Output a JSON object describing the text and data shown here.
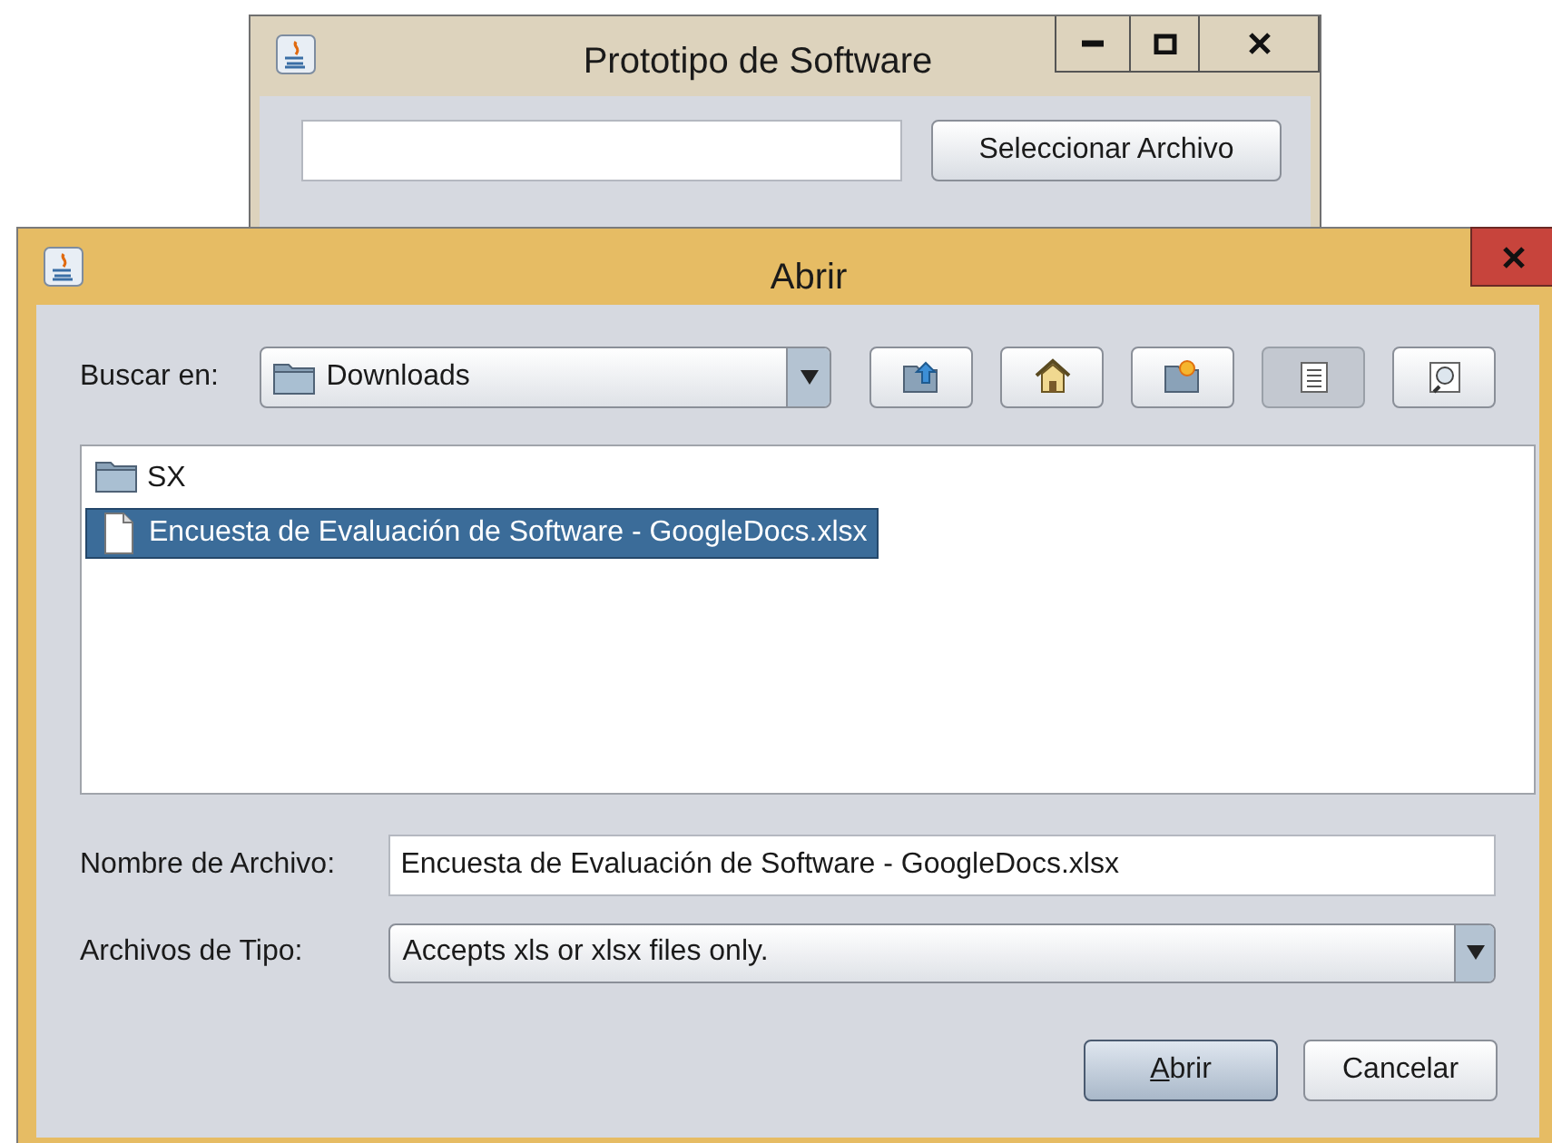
{
  "back_window": {
    "title": "Prototipo de Software",
    "controls": [
      {
        "kind": "minimize"
      },
      {
        "kind": "maximize"
      },
      {
        "kind": "close"
      }
    ],
    "select_button": "Seleccionar Archivo"
  },
  "dialog": {
    "title": "Abrir",
    "look_in": {
      "label": "Buscar en:",
      "value": "Downloads"
    },
    "toolbar": [
      {
        "kind": "up",
        "selected": false
      },
      {
        "kind": "home",
        "selected": false
      },
      {
        "kind": "new-folder",
        "selected": false
      },
      {
        "kind": "list",
        "selected": true
      },
      {
        "kind": "details",
        "selected": false
      }
    ],
    "files": [
      {
        "kind": "folder",
        "name": "SX",
        "selected": false
      },
      {
        "kind": "file",
        "name": "Encuesta de Evaluación de Software - GoogleDocs.xlsx",
        "selected": true
      }
    ],
    "file_name": {
      "label": "Nombre de Archivo:",
      "value": "Encuesta de Evaluación de Software - GoogleDocs.xlsx"
    },
    "file_type": {
      "label": "Archivos de Tipo:",
      "value": "Accepts xls or xlsx files only."
    },
    "buttons": [
      {
        "label": "Abrir",
        "mnemonic": true,
        "default": true
      },
      {
        "label": "Cancelar",
        "default": false
      }
    ]
  }
}
